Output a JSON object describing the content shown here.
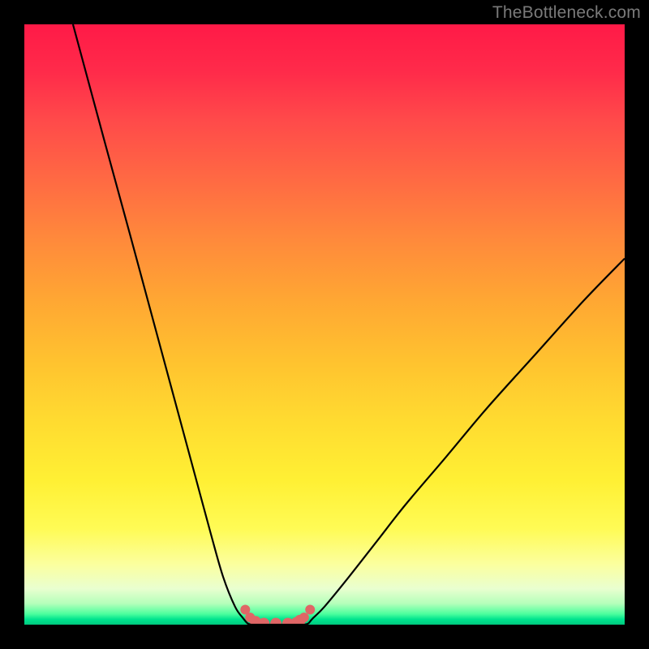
{
  "watermark": {
    "text": "TheBottleneck.com"
  },
  "colors": {
    "frame": "#000000",
    "curve_stroke": "#000000",
    "marker_fill": "#e06666",
    "marker_stroke": "#d94a4a",
    "gradient_top": "#ff1a47",
    "gradient_bottom": "#00c97f"
  },
  "chart_data": {
    "type": "line",
    "title": "",
    "xlabel": "",
    "ylabel": "",
    "xlim": [
      0,
      100
    ],
    "ylim": [
      0,
      100
    ],
    "grid": false,
    "legend": false,
    "description": "Two black curves descending from opposite upper corners converge near a flat valley at roughly x 38–46 at y≈0, forming a V shape. Salmon-colored circular markers cluster along the valley floor where the curves meet the bottom.",
    "series": [
      {
        "name": "left_curve",
        "x": [
          8.1,
          13.5,
          17.6,
          20.3,
          23.0,
          25.7,
          28.4,
          31.1,
          33.1,
          35.1,
          36.5,
          37.2,
          37.8
        ],
        "y": [
          100,
          80,
          65,
          55,
          45,
          35,
          25,
          15,
          8,
          3,
          1,
          0.2,
          0
        ]
      },
      {
        "name": "right_curve",
        "x": [
          46.6,
          47.3,
          48.0,
          50.0,
          54.1,
          58.8,
          63.5,
          70.3,
          77.0,
          85.1,
          93.2,
          100
        ],
        "y": [
          0,
          0.2,
          1,
          3,
          8,
          14,
          20,
          28,
          36,
          45,
          54,
          61
        ]
      },
      {
        "name": "valley_floor",
        "x": [
          37.8,
          39.2,
          40.5,
          41.9,
          43.2,
          44.6,
          45.6,
          46.6
        ],
        "y": [
          0,
          0,
          0,
          0,
          0,
          0,
          0,
          0
        ]
      }
    ],
    "markers": {
      "name": "valley_markers",
      "shape": "circle",
      "x": [
        36.8,
        37.6,
        38.5,
        39.9,
        41.9,
        43.9,
        45.3,
        45.9,
        46.6,
        47.6
      ],
      "y": [
        2.5,
        1.2,
        0.5,
        0.2,
        0.2,
        0.2,
        0.3,
        0.7,
        1.2,
        2.5
      ],
      "radius": [
        6,
        6,
        7,
        7,
        7,
        7,
        7,
        7,
        6,
        6
      ]
    }
  }
}
